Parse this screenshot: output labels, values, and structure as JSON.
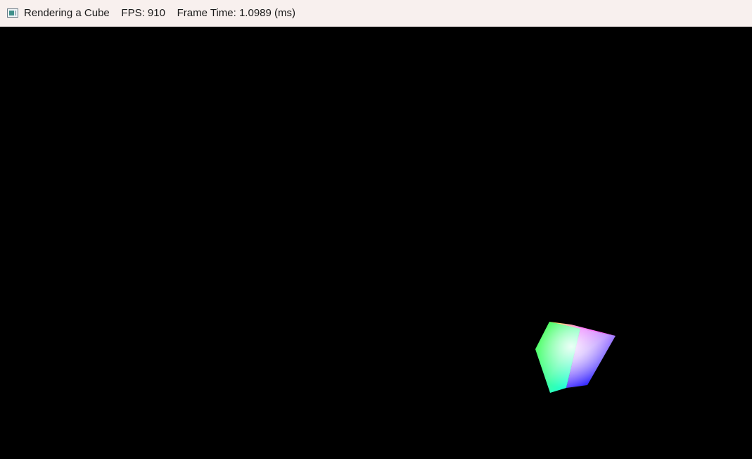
{
  "window": {
    "title": "Rendering a Cube",
    "fps_label": "FPS: 910",
    "frame_time_label": "Frame Time: 1.0989 (ms)",
    "title_full": "Rendering a Cube    FPS: 910    Frame Time: 1.0989 (ms)",
    "icon": "app-window-icon"
  },
  "viewport": {
    "background": "#000000",
    "object": "rgb-gradient-cube",
    "colors": {
      "face_left_top": "#00ff00",
      "face_left_bottom": "#00ffff",
      "face_right_top": "#ff00ff",
      "face_right_bottom": "#0000ff",
      "center": "#ffffff",
      "top_edge": "#ffff00"
    }
  }
}
